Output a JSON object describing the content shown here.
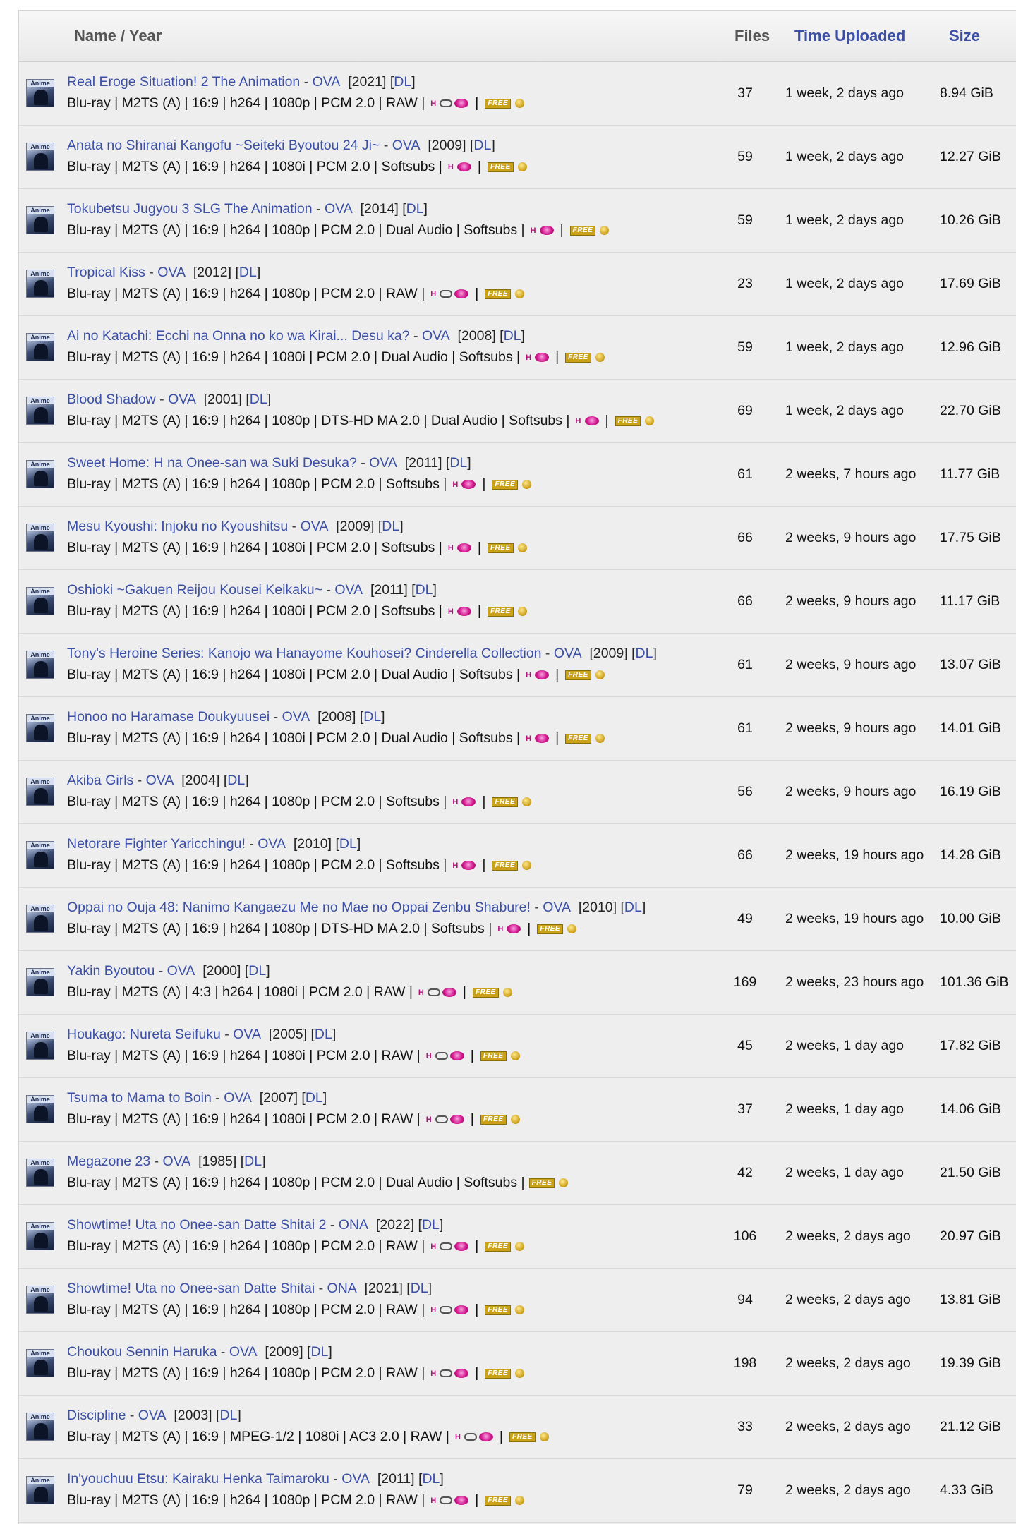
{
  "header": {
    "name_label": "Name / Year",
    "files_label": "Files",
    "time_label": "Time Uploaded",
    "size_label": "Size"
  },
  "category_icon_label": "Anime",
  "badges": {
    "hentai": "H",
    "free": "FREE"
  },
  "dl_label": "DL",
  "rows": [
    {
      "title": "Real Eroge Situation! 2 The Animation",
      "type": "OVA",
      "year": "[2021]",
      "specs": "Blu-ray | M2TS (A) | 16:9 | h264 | 1080p | PCM 2.0 | RAW |",
      "disc": true,
      "files": "37",
      "time": "1 week, 2 days ago",
      "size": "8.94 GiB"
    },
    {
      "title": "Anata no Shiranai Kangofu ~Seiteki Byoutou 24 Ji~",
      "type": "OVA",
      "year": "[2009]",
      "specs": "Blu-ray | M2TS (A) | 16:9 | h264 | 1080i | PCM 2.0 | Softsubs |",
      "disc": false,
      "files": "59",
      "time": "1 week, 2 days ago",
      "size": "12.27 GiB"
    },
    {
      "title": "Tokubetsu Jugyou 3 SLG The Animation",
      "type": "OVA",
      "year": "[2014]",
      "specs": "Blu-ray | M2TS (A) | 16:9 | h264 | 1080p | PCM 2.0 | Dual Audio | Softsubs |",
      "disc": false,
      "files": "59",
      "time": "1 week, 2 days ago",
      "size": "10.26 GiB"
    },
    {
      "title": "Tropical Kiss",
      "type": "OVA",
      "year": "[2012]",
      "specs": "Blu-ray | M2TS (A) | 16:9 | h264 | 1080p | PCM 2.0 | RAW |",
      "disc": true,
      "files": "23",
      "time": "1 week, 2 days ago",
      "size": "17.69 GiB"
    },
    {
      "title": "Ai no Katachi: Ecchi na Onna no ko wa Kirai... Desu ka?",
      "type": "OVA",
      "year": "[2008]",
      "specs": "Blu-ray | M2TS (A) | 16:9 | h264 | 1080i | PCM 2.0 | Dual Audio | Softsubs |",
      "disc": false,
      "files": "59",
      "time": "1 week, 2 days ago",
      "size": "12.96 GiB"
    },
    {
      "title": "Blood Shadow",
      "type": "OVA",
      "year": "[2001]",
      "specs": "Blu-ray | M2TS (A) | 16:9 | h264 | 1080p | DTS-HD MA 2.0 | Dual Audio | Softsubs |",
      "disc": false,
      "files": "69",
      "time": "1 week, 2 days ago",
      "size": "22.70 GiB"
    },
    {
      "title": "Sweet Home: H na Onee-san wa Suki Desuka?",
      "type": "OVA",
      "year": "[2011]",
      "specs": "Blu-ray | M2TS (A) | 16:9 | h264 | 1080p | PCM 2.0 | Softsubs |",
      "disc": false,
      "files": "61",
      "time": "2 weeks, 7 hours ago",
      "size": "11.77 GiB"
    },
    {
      "title": "Mesu Kyoushi: Injoku no Kyoushitsu",
      "type": "OVA",
      "year": "[2009]",
      "specs": "Blu-ray | M2TS (A) | 16:9 | h264 | 1080i | PCM 2.0 | Softsubs |",
      "disc": false,
      "files": "66",
      "time": "2 weeks, 9 hours ago",
      "size": "17.75 GiB"
    },
    {
      "title": "Oshioki ~Gakuen Reijou Kousei Keikaku~",
      "type": "OVA",
      "year": "[2011]",
      "specs": "Blu-ray | M2TS (A) | 16:9 | h264 | 1080i | PCM 2.0 | Softsubs |",
      "disc": false,
      "files": "66",
      "time": "2 weeks, 9 hours ago",
      "size": "11.17 GiB"
    },
    {
      "title": "Tony's Heroine Series: Kanojo wa Hanayome Kouhosei? Cinderella Collection",
      "type": "OVA",
      "year": "[2009]",
      "specs": "Blu-ray | M2TS (A) | 16:9 | h264 | 1080i | PCM 2.0 | Dual Audio | Softsubs |",
      "disc": false,
      "files": "61",
      "time": "2 weeks, 9 hours ago",
      "size": "13.07 GiB"
    },
    {
      "title": "Honoo no Haramase Doukyuusei",
      "type": "OVA",
      "year": "[2008]",
      "specs": "Blu-ray | M2TS (A) | 16:9 | h264 | 1080i | PCM 2.0 | Dual Audio | Softsubs |",
      "disc": false,
      "files": "61",
      "time": "2 weeks, 9 hours ago",
      "size": "14.01 GiB"
    },
    {
      "title": "Akiba Girls",
      "type": "OVA",
      "year": "[2004]",
      "specs": "Blu-ray | M2TS (A) | 16:9 | h264 | 1080p | PCM 2.0 | Softsubs |",
      "disc": false,
      "files": "56",
      "time": "2 weeks, 9 hours ago",
      "size": "16.19 GiB"
    },
    {
      "title": "Netorare Fighter Yaricchingu!",
      "type": "OVA",
      "year": "[2010]",
      "specs": "Blu-ray | M2TS (A) | 16:9 | h264 | 1080p | PCM 2.0 | Softsubs |",
      "disc": false,
      "files": "66",
      "time": "2 weeks, 19 hours ago",
      "size": "14.28 GiB"
    },
    {
      "title": "Oppai no Ouja 48: Nanimo Kangaezu Me no Mae no Oppai Zenbu Shabure!",
      "type": "OVA",
      "year": "[2010]",
      "specs": "Blu-ray | M2TS (A) | 16:9 | h264 | 1080p | DTS-HD MA 2.0 | Softsubs |",
      "disc": false,
      "files": "49",
      "time": "2 weeks, 19 hours ago",
      "size": "10.00 GiB"
    },
    {
      "title": "Yakin Byoutou",
      "type": "OVA",
      "year": "[2000]",
      "specs": "Blu-ray | M2TS (A) | 4:3 | h264 | 1080i | PCM 2.0 | RAW |",
      "disc": true,
      "files": "169",
      "time": "2 weeks, 23 hours ago",
      "size": "101.36 GiB"
    },
    {
      "title": "Houkago: Nureta Seifuku",
      "type": "OVA",
      "year": "[2005]",
      "specs": "Blu-ray | M2TS (A) | 16:9 | h264 | 1080i | PCM 2.0 | RAW |",
      "disc": true,
      "files": "45",
      "time": "2 weeks, 1 day ago",
      "size": "17.82 GiB"
    },
    {
      "title": "Tsuma to Mama to Boin",
      "type": "OVA",
      "year": "[2007]",
      "specs": "Blu-ray | M2TS (A) | 16:9 | h264 | 1080i | PCM 2.0 | RAW |",
      "disc": true,
      "files": "37",
      "time": "2 weeks, 1 day ago",
      "size": "14.06 GiB"
    },
    {
      "title": "Megazone 23",
      "type": "OVA",
      "year": "[1985]",
      "specs": "Blu-ray | M2TS (A) | 16:9 | h264 | 1080p | PCM 2.0 | Dual Audio | Softsubs |",
      "disc": false,
      "hentai": false,
      "files": "42",
      "time": "2 weeks, 1 day ago",
      "size": "21.50 GiB"
    },
    {
      "title": "Showtime! Uta no Onee-san Datte Shitai 2",
      "type": "ONA",
      "year": "[2022]",
      "specs": "Blu-ray | M2TS (A) | 16:9 | h264 | 1080p | PCM 2.0 | RAW |",
      "disc": true,
      "files": "106",
      "time": "2 weeks, 2 days ago",
      "size": "20.97 GiB"
    },
    {
      "title": "Showtime! Uta no Onee-san Datte Shitai",
      "type": "ONA",
      "year": "[2021]",
      "specs": "Blu-ray | M2TS (A) | 16:9 | h264 | 1080p | PCM 2.0 | RAW |",
      "disc": true,
      "files": "94",
      "time": "2 weeks, 2 days ago",
      "size": "13.81 GiB"
    },
    {
      "title": "Choukou Sennin Haruka",
      "type": "OVA",
      "year": "[2009]",
      "specs": "Blu-ray | M2TS (A) | 16:9 | h264 | 1080p | PCM 2.0 | RAW |",
      "disc": true,
      "files": "198",
      "time": "2 weeks, 2 days ago",
      "size": "19.39 GiB"
    },
    {
      "title": "Discipline",
      "type": "OVA",
      "year": "[2003]",
      "specs": "Blu-ray | M2TS (A) | 16:9 | MPEG-1/2 | 1080i | AC3 2.0 | RAW |",
      "disc": true,
      "files": "33",
      "time": "2 weeks, 2 days ago",
      "size": "21.12 GiB"
    },
    {
      "title": "In'youchuu Etsu: Kairaku Henka Taimaroku",
      "type": "OVA",
      "year": "[2011]",
      "specs": "Blu-ray | M2TS (A) | 16:9 | h264 | 1080p | PCM 2.0 | RAW |",
      "disc": true,
      "files": "79",
      "time": "2 weeks, 2 days ago",
      "size": "4.33 GiB"
    }
  ]
}
